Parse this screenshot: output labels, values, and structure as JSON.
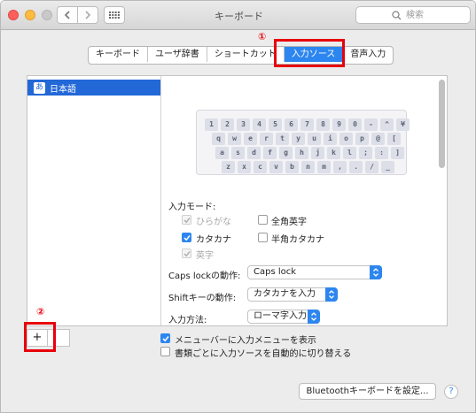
{
  "window": {
    "title": "キーボード"
  },
  "search": {
    "placeholder": "検索"
  },
  "tabs": [
    {
      "label": "キーボード"
    },
    {
      "label": "ユーザ辞書"
    },
    {
      "label": "ショートカット"
    },
    {
      "label": "入力ソース",
      "active": true
    },
    {
      "label": "音声入力"
    }
  ],
  "annotations": {
    "marker1": "①",
    "marker2": "②"
  },
  "sources": [
    {
      "icon_char": "あ",
      "label": "日本語",
      "selected": true
    }
  ],
  "keyboard_rows": [
    [
      "1",
      "2",
      "3",
      "4",
      "5",
      "6",
      "7",
      "8",
      "9",
      "0",
      "-",
      "^",
      "¥"
    ],
    [
      "q",
      "w",
      "e",
      "r",
      "t",
      "y",
      "u",
      "i",
      "o",
      "p",
      "@",
      "["
    ],
    [
      "a",
      "s",
      "d",
      "f",
      "g",
      "h",
      "j",
      "k",
      "l",
      ";",
      ":",
      "]"
    ],
    [
      "z",
      "x",
      "c",
      "v",
      "b",
      "n",
      "m",
      ",",
      ".",
      "/",
      "_"
    ]
  ],
  "input_modes": {
    "heading": "入力モード:",
    "hiragana": {
      "label": "ひらがな",
      "checked": true,
      "disabled": true
    },
    "zenkaku": {
      "label": "全角英字",
      "checked": false
    },
    "katakana": {
      "label": "カタカナ",
      "checked": true
    },
    "hankaku": {
      "label": "半角カタカナ",
      "checked": false
    },
    "eiji": {
      "label": "英字",
      "checked": true,
      "disabled": true
    }
  },
  "caps_lock": {
    "label": "Caps lockの動作:",
    "value": "Caps lock"
  },
  "shift": {
    "label": "Shiftキーの動作:",
    "value": "カタカナを入力"
  },
  "input_method": {
    "label": "入力方法:",
    "value": "ローマ字入力"
  },
  "list_buttons": {
    "add": "+",
    "remove": "−"
  },
  "options": {
    "show_menu": {
      "label": "メニューバーに入力メニューを表示",
      "checked": true
    },
    "auto_switch": {
      "label": "書類ごとに入力ソースを自動的に切り替える",
      "checked": false
    }
  },
  "bluetooth_button": "Bluetoothキーボードを設定...",
  "help_button": "?",
  "colors": {
    "accent": "#2d86ef",
    "selection": "#2268d7",
    "annotation": "#e8000b"
  }
}
